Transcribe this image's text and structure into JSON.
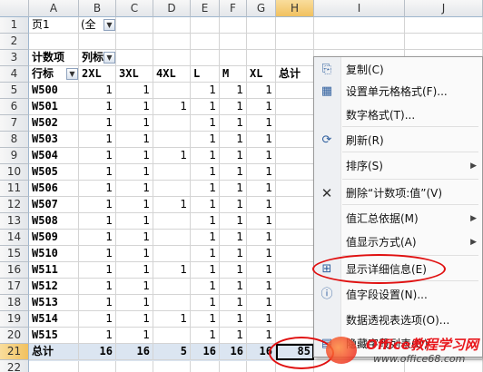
{
  "columns": [
    "A",
    "B",
    "C",
    "D",
    "E",
    "F",
    "G",
    "H",
    "I",
    "J"
  ],
  "rows": [
    "1",
    "2",
    "3",
    "4",
    "5",
    "6",
    "7",
    "8",
    "9",
    "10",
    "11",
    "12",
    "13",
    "14",
    "15",
    "16",
    "17",
    "18",
    "19",
    "20",
    "21",
    "22"
  ],
  "filter": {
    "label": "页1",
    "value": "(全"
  },
  "pivot": {
    "header_label": "计数项",
    "col_label": "列标",
    "row_label": "行标",
    "sizes": [
      "2XL",
      "3XL",
      "4XL",
      "L",
      "M",
      "XL",
      "总计"
    ],
    "items": [
      {
        "name": "W500",
        "v": [
          "1",
          "1",
          "",
          "1",
          "1",
          "1"
        ]
      },
      {
        "name": "W501",
        "v": [
          "1",
          "1",
          "1",
          "1",
          "1",
          "1"
        ]
      },
      {
        "name": "W502",
        "v": [
          "1",
          "1",
          "",
          "1",
          "1",
          "1"
        ]
      },
      {
        "name": "W503",
        "v": [
          "1",
          "1",
          "",
          "1",
          "1",
          "1"
        ]
      },
      {
        "name": "W504",
        "v": [
          "1",
          "1",
          "1",
          "1",
          "1",
          "1"
        ]
      },
      {
        "name": "W505",
        "v": [
          "1",
          "1",
          "",
          "1",
          "1",
          "1"
        ]
      },
      {
        "name": "W506",
        "v": [
          "1",
          "1",
          "",
          "1",
          "1",
          "1"
        ]
      },
      {
        "name": "W507",
        "v": [
          "1",
          "1",
          "1",
          "1",
          "1",
          "1"
        ]
      },
      {
        "name": "W508",
        "v": [
          "1",
          "1",
          "",
          "1",
          "1",
          "1"
        ]
      },
      {
        "name": "W509",
        "v": [
          "1",
          "1",
          "",
          "1",
          "1",
          "1"
        ]
      },
      {
        "name": "W510",
        "v": [
          "1",
          "1",
          "",
          "1",
          "1",
          "1"
        ]
      },
      {
        "name": "W511",
        "v": [
          "1",
          "1",
          "1",
          "1",
          "1",
          "1"
        ]
      },
      {
        "name": "W512",
        "v": [
          "1",
          "1",
          "",
          "1",
          "1",
          "1"
        ]
      },
      {
        "name": "W513",
        "v": [
          "1",
          "1",
          "",
          "1",
          "1",
          "1"
        ]
      },
      {
        "name": "W514",
        "v": [
          "1",
          "1",
          "1",
          "1",
          "1",
          "1"
        ]
      },
      {
        "name": "W515",
        "v": [
          "1",
          "1",
          "",
          "1",
          "1",
          "1"
        ]
      }
    ],
    "total": {
      "label": "总计",
      "v": [
        "16",
        "16",
        "5",
        "16",
        "16",
        "16",
        "85"
      ]
    }
  },
  "menu": {
    "items": [
      {
        "label": "复制(C)",
        "icon": "copy-icon",
        "glyph": "⎘",
        "arrow": false
      },
      {
        "label": "设置单元格格式(F)...",
        "icon": "format-cells-icon",
        "glyph": "▦",
        "arrow": false
      },
      {
        "label": "数字格式(T)...",
        "icon": "",
        "glyph": "",
        "arrow": false
      },
      {
        "label": "刷新(R)",
        "icon": "refresh-icon",
        "glyph": "⟳",
        "arrow": false
      },
      {
        "label": "排序(S)",
        "icon": "",
        "glyph": "",
        "arrow": true
      },
      {
        "label": "删除“计数项:值”(V)",
        "icon": "delete-x-icon",
        "glyph": "✕",
        "arrow": false
      },
      {
        "label": "值汇总依据(M)",
        "icon": "",
        "glyph": "",
        "arrow": true
      },
      {
        "label": "值显示方式(A)",
        "icon": "",
        "glyph": "",
        "arrow": true
      },
      {
        "label": "显示详细信息(E)",
        "icon": "show-details-icon",
        "glyph": "⊞",
        "arrow": false
      },
      {
        "label": "值字段设置(N)...",
        "icon": "field-settings-icon",
        "glyph": "ⓘ",
        "arrow": false
      },
      {
        "label": "数据透视表选项(O)...",
        "icon": "",
        "glyph": "",
        "arrow": false
      },
      {
        "label": "隐藏字段列表(D)",
        "icon": "field-list-icon",
        "glyph": "▤",
        "arrow": false
      }
    ]
  },
  "watermark": {
    "brand": "Office教程学习网",
    "url": "www.office68.com"
  },
  "colors": {
    "highlight_circle": "#e01010",
    "header_selected": "#f1c15f",
    "total_row": "#dbe5f1"
  }
}
